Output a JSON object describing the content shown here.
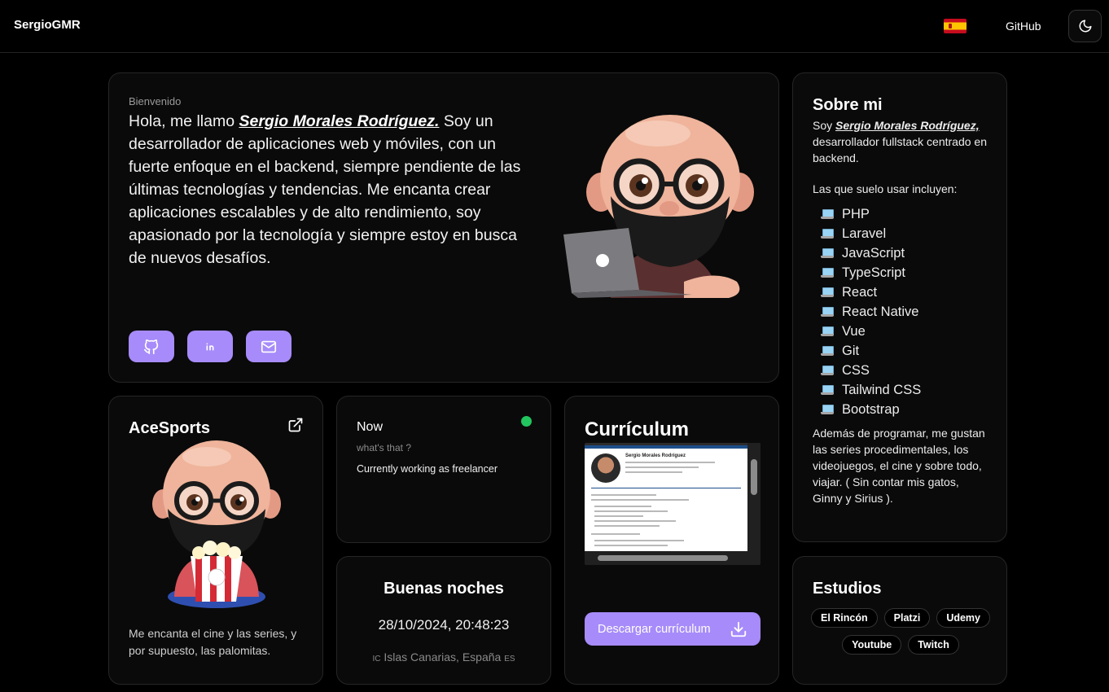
{
  "header": {
    "brand": "SergioGMR",
    "github_label": "GitHub",
    "language_flag": "es-flag-icon",
    "theme_icon": "moon-icon"
  },
  "hero": {
    "small_label": "Bienvenido",
    "text_before": "Hola, me llamo ",
    "name": "Sergio Morales Rodríguez.",
    "text_after": " Soy un desarrollador de aplicaciones web y móviles, con un fuerte enfoque en el backend, siempre pendiente de las últimas tecnologías y tendencias. Me encanta crear aplicaciones escalables y de alto rendimiento, soy apasionado por la tecnología y siempre estoy en busca de nuevos desafíos.",
    "social": [
      {
        "icon": "github-icon"
      },
      {
        "icon": "linkedin-icon"
      },
      {
        "icon": "mail-icon"
      }
    ]
  },
  "about": {
    "title": "Sobre mi",
    "intro_before": "Soy ",
    "name": "Sergio Morales Rodríguez,",
    "intro_after": " desarrollador fullstack centrado en backend.",
    "lead": "Las que suelo usar incluyen:",
    "technologies": [
      "PHP",
      "Laravel",
      "JavaScript",
      "TypeScript",
      "React",
      "React Native",
      "Vue",
      "Git",
      "CSS",
      "Tailwind CSS",
      "Bootstrap"
    ],
    "extra": "Además de programar, me gustan las series procedimentales, los videojuegos, el cine y sobre todo, viajar. ( Sin contar mis gatos, Ginny y Sirius )."
  },
  "ace": {
    "title": "AceSports",
    "caption": "Me encanta el cine y las series, y por supuesto, las palomitas."
  },
  "now": {
    "title": "Now",
    "subtitle": "what's that ?",
    "status": "Currently working as freelancer",
    "status_color": "#22c55e"
  },
  "greeting": {
    "title": "Buenas noches",
    "datetime": "28/10/2024, 20:48:23",
    "location_prefix": "IC",
    "location": "Islas Canarias, España",
    "location_suffix": "ES"
  },
  "cv": {
    "title": "Currículum",
    "preview_name": "Sergio Morales Rodríguez",
    "download_label": "Descargar currículum"
  },
  "studies": {
    "title": "Estudios",
    "items": [
      "El Rincón",
      "Platzi",
      "Udemy",
      "Youtube",
      "Twitch"
    ]
  },
  "colors": {
    "accent": "#a78bfa",
    "background": "#000000",
    "card": "#0a0a0a",
    "border": "#262626"
  }
}
